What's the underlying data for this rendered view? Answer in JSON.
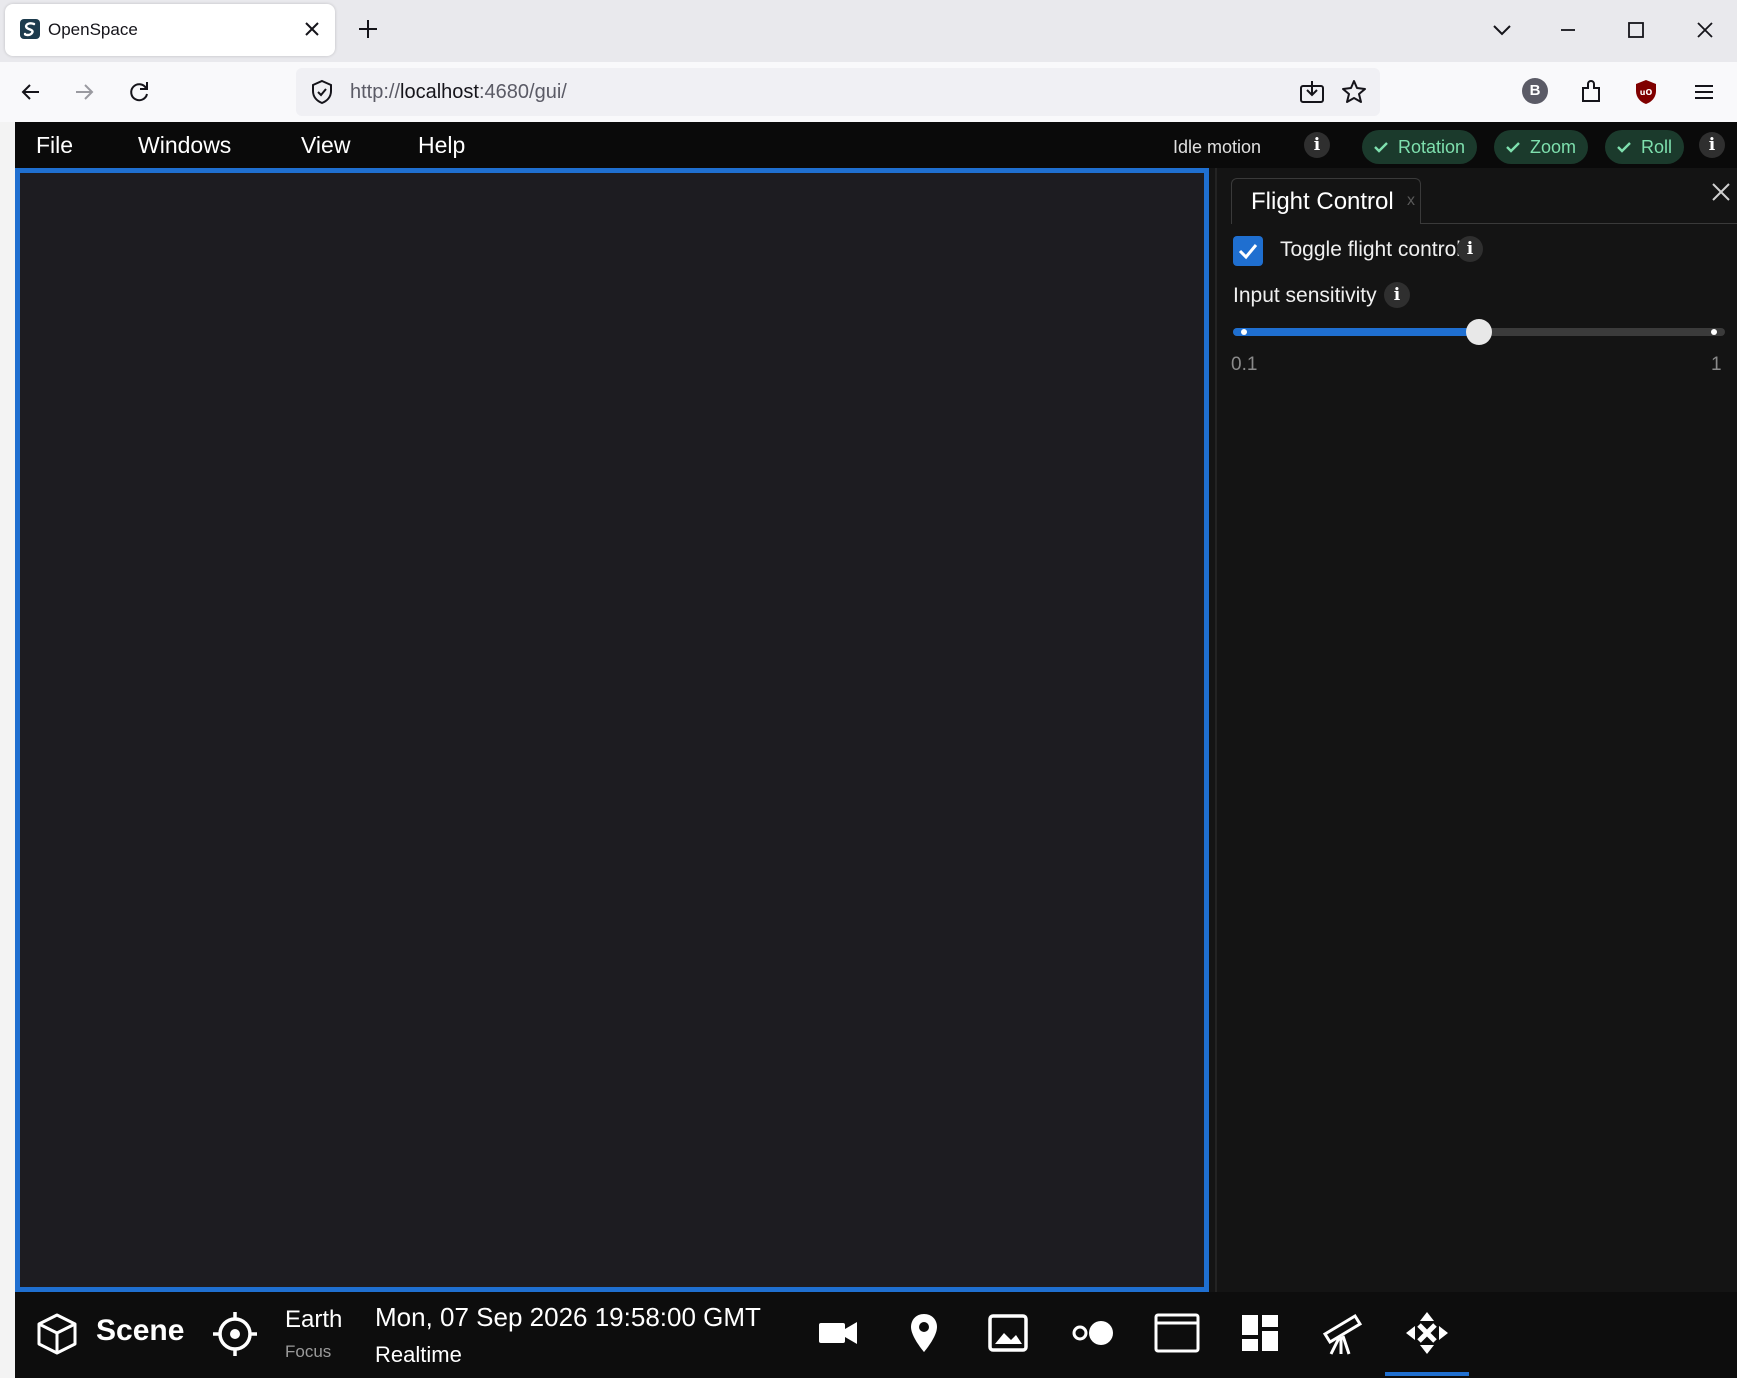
{
  "browser": {
    "tab_title": "OpenSpace",
    "url_scheme": "http://",
    "url_host": "localhost",
    "url_rest": ":4680/gui/",
    "profile_initial": "B"
  },
  "app": {
    "menu": [
      "File",
      "Windows",
      "View",
      "Help"
    ],
    "idle_motion_label": "Idle motion",
    "toggles": [
      "Rotation",
      "Zoom",
      "Roll"
    ],
    "accent_color": "#1f6fd0",
    "toggle_color": "#7ee0ae"
  },
  "panel": {
    "tab_label": "Flight Control",
    "tab_close": "x",
    "toggle_label": "Toggle flight control",
    "toggle_checked": true,
    "sensitivity_label": "Input sensitivity",
    "slider_min": "0.1",
    "slider_max": "1",
    "slider_fraction": 0.5
  },
  "bottom": {
    "scene_label": "Scene",
    "focus_name": "Earth",
    "focus_sub": "Focus",
    "date": "Mon, 07 Sep 2026 19:58:00 GMT",
    "time_mode": "Realtime",
    "tools": [
      "camera-icon",
      "location-pin-icon",
      "image-icon",
      "recording-icon",
      "window-icon",
      "dashboard-icon",
      "telescope-icon",
      "flight-move-icon"
    ]
  }
}
